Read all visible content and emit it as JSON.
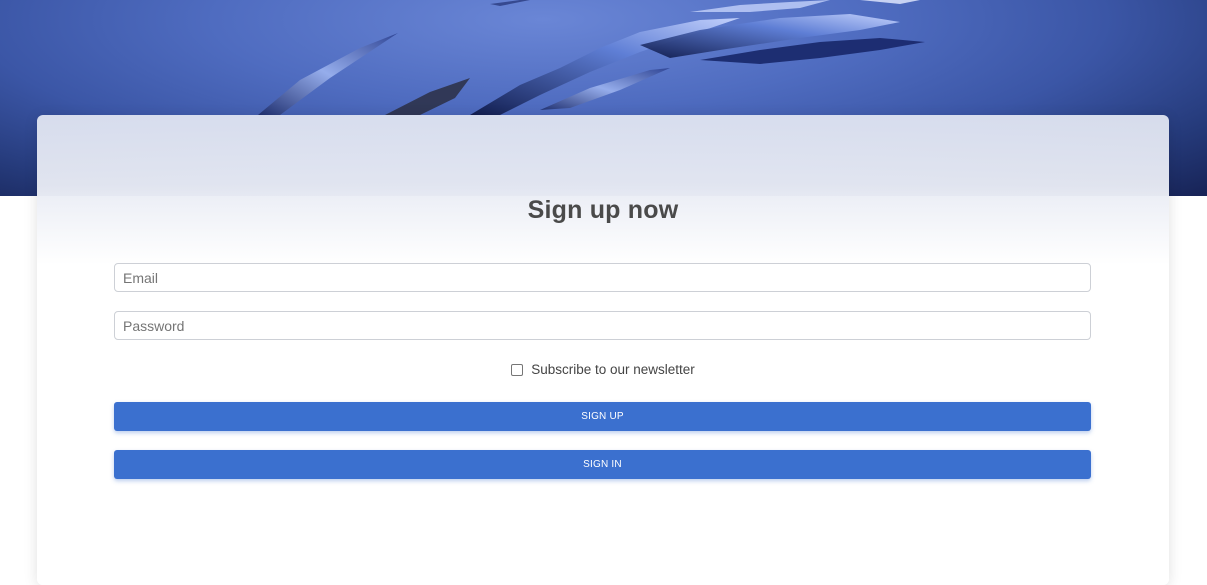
{
  "hero": {
    "background_icon": "abstract-blue-shards"
  },
  "form": {
    "title": "Sign up now",
    "email_placeholder": "Email",
    "email_value": "",
    "password_placeholder": "Password",
    "password_value": "",
    "newsletter_label": "Subscribe to our newsletter",
    "newsletter_checked": false,
    "signup_label": "SIGN UP",
    "signin_label": "SIGN IN"
  },
  "colors": {
    "primary_button": "#3b70cf",
    "hero_dark": "#172356",
    "hero_light": "#6a86d6",
    "title_text": "#4a4a4a"
  }
}
